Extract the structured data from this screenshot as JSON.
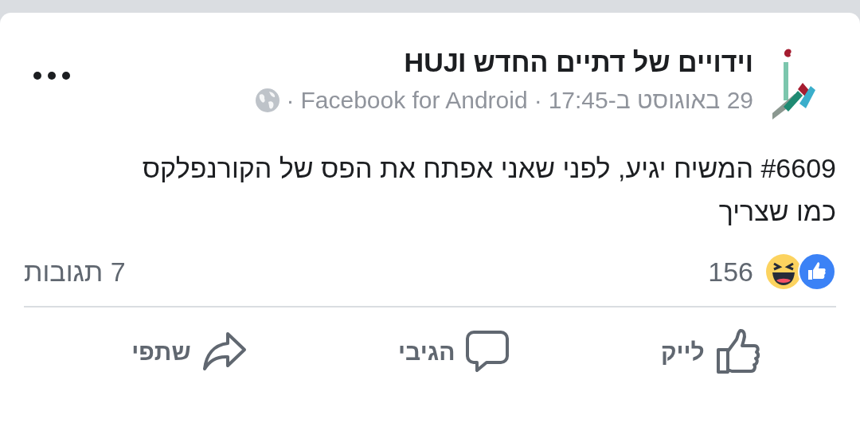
{
  "post": {
    "author": "וידויים של דתיים החדש HUJI",
    "timestamp": "29 באוגוסט ב-17:45",
    "separators": [
      "·",
      "·"
    ],
    "app": "Facebook for Android",
    "text": "#6609 המשיח יגיע, לפני שאני אפתח את הפס של הקורנפלקס כמו שצריך",
    "reactions_count": "156",
    "comments": "7 תגובות"
  },
  "actions": [
    {
      "kind": "like",
      "label": "לייק"
    },
    {
      "kind": "comment",
      "label": "הגיבי"
    },
    {
      "kind": "share",
      "label": "שתפי"
    }
  ]
}
